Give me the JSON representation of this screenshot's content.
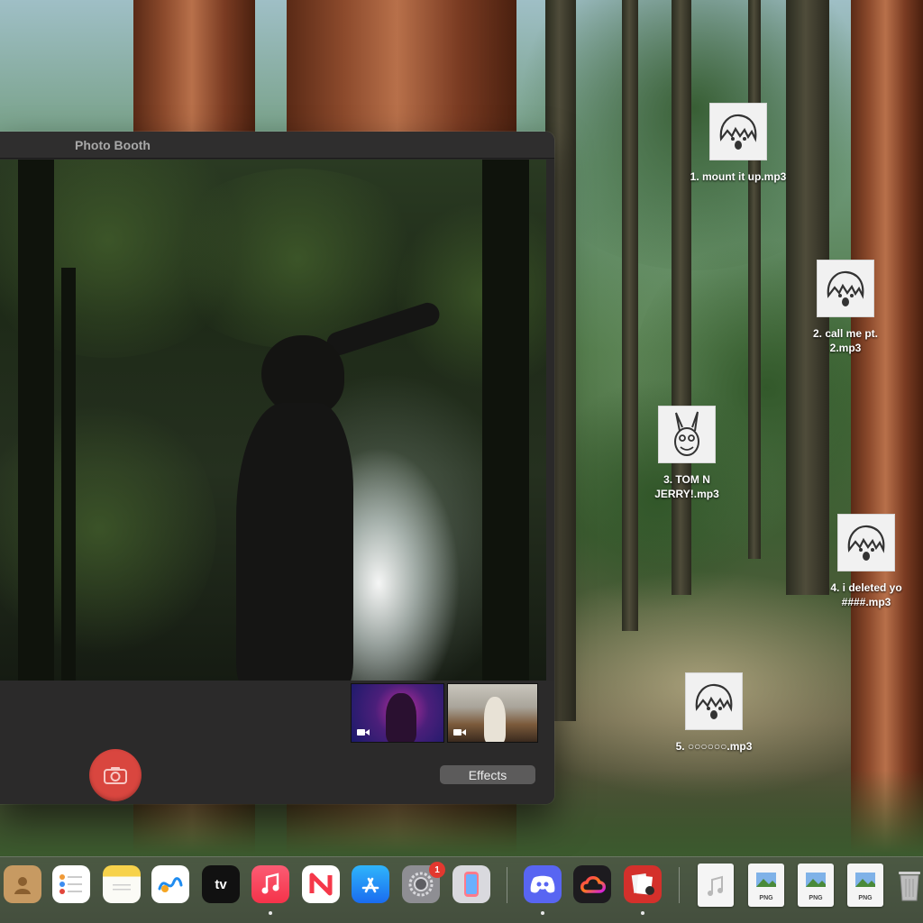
{
  "window": {
    "title": "Photo Booth",
    "effects_label": "Effects",
    "shutter_icon": "camera-icon",
    "accent_color": "#d9463f"
  },
  "thumbnails": [
    {
      "name": "thumbnail-1",
      "icon": "video-camera-icon"
    },
    {
      "name": "thumbnail-2",
      "icon": "video-camera-icon"
    }
  ],
  "desktop_files": [
    {
      "label_line1": "1. mount it up.mp3",
      "label_line2": "",
      "art": "cartoon-face"
    },
    {
      "label_line1": "2. call me pt.",
      "label_line2": "2.mp3",
      "art": "cartoon-face"
    },
    {
      "label_line1": "3. TOM N",
      "label_line2": "JERRY!.mp3",
      "art": "cartoon-bunny"
    },
    {
      "label_line1": "4. i deleted yo",
      "label_line2": "####.mp3",
      "art": "cartoon-face"
    },
    {
      "label_line1": "5. ○○○○○○.mp3",
      "label_line2": "",
      "art": "cartoon-face"
    }
  ],
  "dock": {
    "apps": [
      {
        "name": "Contacts",
        "icon": "contacts-icon",
        "running": false
      },
      {
        "name": "Reminders",
        "icon": "reminders-icon",
        "running": false
      },
      {
        "name": "Notes",
        "icon": "notes-icon",
        "running": false
      },
      {
        "name": "Freeform",
        "icon": "freeform-icon",
        "running": false
      },
      {
        "name": "TV",
        "label": "tv",
        "icon": "apple-tv-icon",
        "running": false
      },
      {
        "name": "Music",
        "icon": "music-icon",
        "running": true
      },
      {
        "name": "News",
        "icon": "news-icon",
        "running": false
      },
      {
        "name": "App Store",
        "icon": "app-store-icon",
        "running": false
      },
      {
        "name": "System Settings",
        "icon": "settings-icon",
        "running": false,
        "badge": "1"
      },
      {
        "name": "iPhone Mirroring",
        "icon": "iphone-mirroring-icon",
        "running": false
      },
      {
        "name": "Discord",
        "icon": "discord-icon",
        "running": true
      },
      {
        "name": "Creative Cloud",
        "icon": "creative-cloud-icon",
        "running": false
      },
      {
        "name": "Photo Booth",
        "icon": "photo-booth-icon",
        "running": true
      }
    ],
    "documents": [
      {
        "icon": "audio-file-icon",
        "tag": ""
      },
      {
        "icon": "png-file-icon",
        "tag": "PNG"
      },
      {
        "icon": "png-file-icon",
        "tag": "PNG"
      },
      {
        "icon": "png-file-icon",
        "tag": "PNG"
      }
    ],
    "trash_icon": "trash-icon"
  }
}
